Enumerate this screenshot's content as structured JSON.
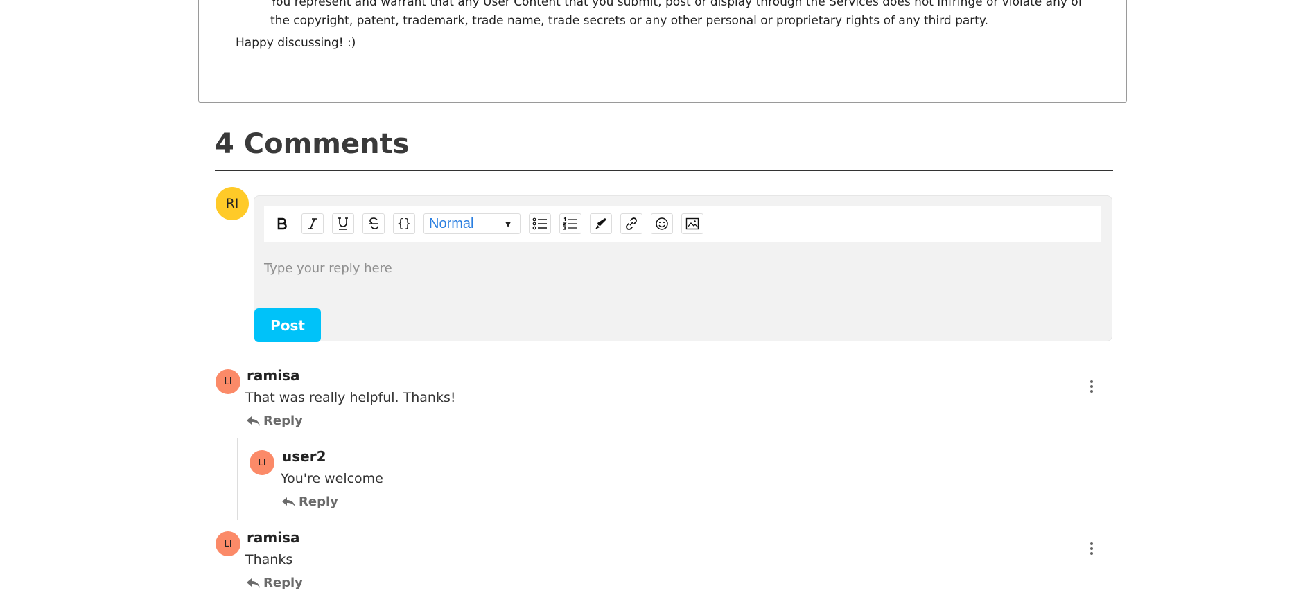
{
  "post": {
    "legal_text": "You represent and warrant that any User Content that you submit, post or display through the Services does not infringe or violate any of the copyright, patent, trademark, trade name, trade secrets or any other personal or proprietary rights of any third party.",
    "closing": "Happy discussing! :)"
  },
  "comments_section": {
    "title": "4 Comments",
    "current_user_initials": "RI",
    "editor": {
      "format_select": "Normal",
      "placeholder": "Type your reply here",
      "post_label": "Post",
      "toolbar_icons": [
        "bold-icon",
        "italic-icon",
        "underline-icon",
        "strikethrough-icon",
        "code-block-icon",
        "format-select",
        "bullet-list-icon",
        "ordered-list-icon",
        "highlight-pen-icon",
        "link-icon",
        "emoji-icon",
        "image-icon"
      ]
    },
    "comments": [
      {
        "initials": "LI",
        "author": "ramisa",
        "text": "That was really helpful. Thanks!",
        "reply_label": "Reply"
      },
      {
        "initials": "LI",
        "author": "user2",
        "text": "You're welcome",
        "reply_label": "Reply"
      },
      {
        "initials": "LI",
        "author": "ramisa",
        "text": "Thanks",
        "reply_label": "Reply"
      }
    ]
  },
  "colors": {
    "current_user_avatar": "#ffca28",
    "commenter_avatar": "#fb8a68",
    "post_button": "#00c2f9",
    "format_select_text": "#2b7fe0"
  }
}
